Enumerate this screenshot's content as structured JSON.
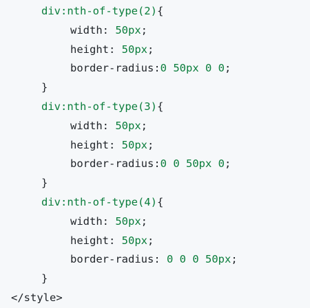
{
  "blocks": [
    {
      "selector": "div:nth-of-type(2)",
      "open_brace": "{",
      "close_brace": "}",
      "rules": [
        {
          "prop": "width",
          "sep": ": ",
          "value": "50px",
          "end": ";"
        },
        {
          "prop": "height",
          "sep": ": ",
          "value": "50px",
          "end": ";"
        },
        {
          "prop": "border-radius",
          "sep": ":",
          "value": "0 50px 0 0",
          "end": ";"
        }
      ]
    },
    {
      "selector": "div:nth-of-type(3)",
      "open_brace": "{",
      "close_brace": "}",
      "rules": [
        {
          "prop": "width",
          "sep": ": ",
          "value": "50px",
          "end": ";"
        },
        {
          "prop": "height",
          "sep": ": ",
          "value": "50px",
          "end": ";"
        },
        {
          "prop": "border-radius",
          "sep": ":",
          "value": "0 0 50px 0",
          "end": ";"
        }
      ]
    },
    {
      "selector": "div:nth-of-type(4)",
      "open_brace": "{",
      "close_brace": "}",
      "rules": [
        {
          "prop": "width",
          "sep": ": ",
          "value": "50px",
          "end": ";"
        },
        {
          "prop": "height",
          "sep": ": ",
          "value": "50px",
          "end": ";"
        },
        {
          "prop": "border-radius",
          "sep": ": ",
          "value": "0 0 0 50px",
          "end": ";"
        }
      ]
    }
  ],
  "closing_tag": "</style>",
  "colors": {
    "background": "#f6f8fa",
    "text": "#1f2328",
    "green": "#0a7d3b"
  }
}
